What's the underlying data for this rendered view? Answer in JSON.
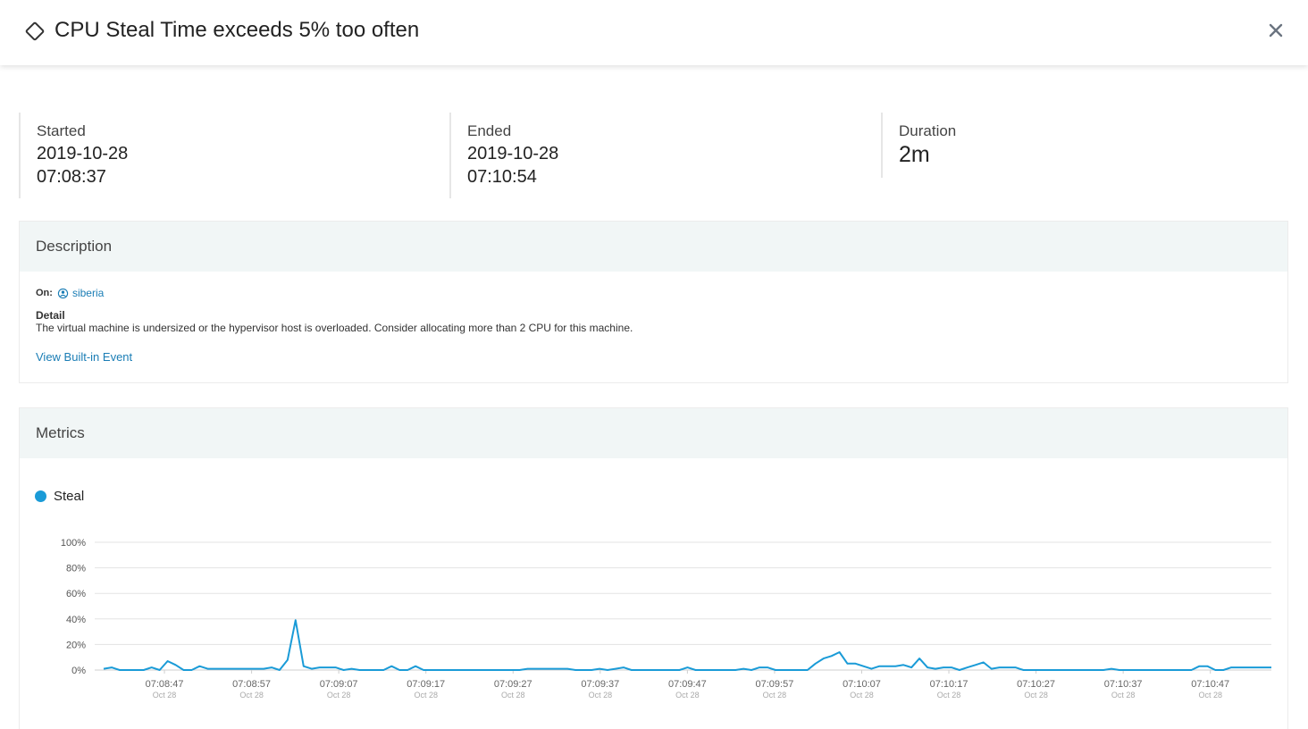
{
  "header": {
    "title": "CPU Steal Time exceeds 5% too often",
    "icon": "diamond-icon",
    "close_icon": "close-icon"
  },
  "stats": {
    "started": {
      "label": "Started",
      "date": "2019-10-28",
      "time": "07:08:37"
    },
    "ended": {
      "label": "Ended",
      "date": "2019-10-28",
      "time": "07:10:54"
    },
    "duration": {
      "label": "Duration",
      "value": "2m"
    }
  },
  "description": {
    "title": "Description",
    "on_label": "On:",
    "host": "siberia",
    "host_icon": "host-icon",
    "detail_label": "Detail",
    "detail_text": "The virtual machine is undersized or the hypervisor host is overloaded. Consider allocating more than 2 CPU for this machine.",
    "view_link": "View Built-in Event"
  },
  "metrics": {
    "title": "Metrics",
    "legend": "Steal",
    "color": "#1a9bd7"
  },
  "chart_data": {
    "type": "line",
    "series": [
      {
        "name": "Steal",
        "color": "#1a9bd7"
      }
    ],
    "y_ticks": [
      "100%",
      "80%",
      "60%",
      "40%",
      "20%",
      "0%"
    ],
    "ylim": [
      0,
      100
    ],
    "x_ticks": [
      {
        "time": "07:08:47",
        "date": "Oct 28"
      },
      {
        "time": "07:08:57",
        "date": "Oct 28"
      },
      {
        "time": "07:09:07",
        "date": "Oct 28"
      },
      {
        "time": "07:09:17",
        "date": "Oct 28"
      },
      {
        "time": "07:09:27",
        "date": "Oct 28"
      },
      {
        "time": "07:09:37",
        "date": "Oct 28"
      },
      {
        "time": "07:09:47",
        "date": "Oct 28"
      },
      {
        "time": "07:09:57",
        "date": "Oct 28"
      },
      {
        "time": "07:10:07",
        "date": "Oct 28"
      },
      {
        "time": "07:10:17",
        "date": "Oct 28"
      },
      {
        "time": "07:10:27",
        "date": "Oct 28"
      },
      {
        "time": "07:10:37",
        "date": "Oct 28"
      },
      {
        "time": "07:10:47",
        "date": "Oct 28"
      }
    ],
    "x_start": "07:08:39",
    "x_end": "07:10:54",
    "steal_values": [
      1,
      2,
      0,
      0,
      0,
      0,
      2,
      0,
      7,
      4,
      0,
      0,
      3,
      1,
      1,
      1,
      1,
      1,
      1,
      1,
      1,
      2,
      0,
      8,
      39,
      3,
      1,
      2,
      2,
      2,
      0,
      1,
      0,
      0,
      0,
      0,
      3,
      0,
      0,
      3,
      0,
      0,
      0,
      0,
      0,
      0,
      0,
      0,
      0,
      0,
      0,
      0,
      0,
      1,
      1,
      1,
      1,
      1,
      1,
      0,
      0,
      0,
      1,
      0,
      1,
      2,
      0,
      0,
      0,
      0,
      0,
      0,
      0,
      2,
      0,
      0,
      0,
      0,
      0,
      0,
      1,
      0,
      2,
      2,
      0,
      0,
      0,
      0,
      0,
      5,
      9,
      11,
      14,
      5,
      5,
      3,
      1,
      3,
      3,
      3,
      4,
      2,
      9,
      2,
      1,
      2,
      2,
      0,
      2,
      4,
      6,
      1,
      2,
      2,
      2,
      0,
      0,
      0,
      0,
      0,
      0,
      0,
      0,
      0,
      0,
      0,
      1,
      0,
      0,
      0,
      0,
      0,
      0,
      0,
      0,
      0,
      0,
      3,
      3,
      0,
      0,
      2,
      2,
      2,
      2,
      2,
      2
    ]
  }
}
